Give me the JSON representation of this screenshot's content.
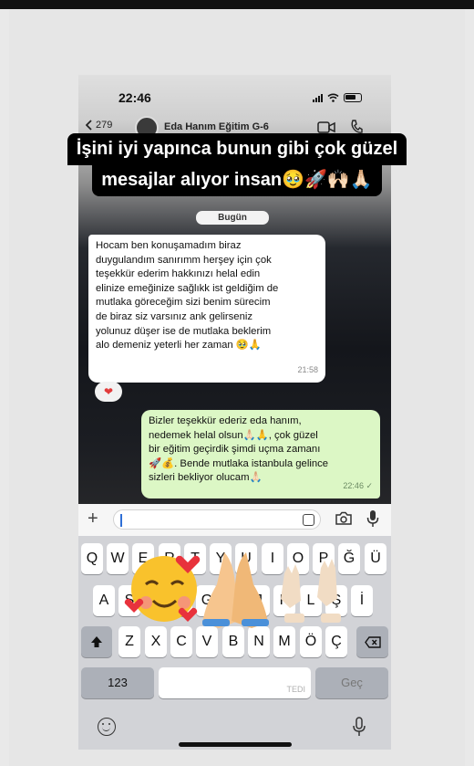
{
  "status_bar": {
    "time": "22:46"
  },
  "chat": {
    "back_count": "279",
    "contact_name": "Eda Hanım Eğitim G-6",
    "date_divider": "Bugün",
    "incoming": {
      "lines": [
        "Hocam ben konuşamadım biraz",
        "duygulandım sanırımm herşey için çok",
        "teşekkür ederim hakkınızı helal edin",
        "elinize emeğinize sağlıkk ist geldiğim de",
        "mutlaka göreceğim sizi  benim sürecim",
        "de biraz siz varsınız ank gelirseniz",
        "yolunuz düşer ise de mutlaka beklerim",
        "alo demeniz yeterli her zaman 🥹🙏"
      ],
      "time": "21:58",
      "reaction": "❤"
    },
    "outgoing": {
      "lines": [
        "Bizler teşekkür ederiz eda hanım,",
        "nedemek helal olsun🙏🏻🙏, çok güzel",
        "bir eğitim geçirdik şimdi uçma zamanı",
        "🚀💰. Bende mutlaka istanbula gelince",
        "sizleri bekliyor olucam🙏🏻"
      ],
      "time": "22:46 ✓"
    }
  },
  "story_caption": {
    "line1": "İşini iyi yapınca bunun gibi çok güzel",
    "line2": "mesajlar alıyor insan🥹🚀🙌🏻🙏🏻"
  },
  "keyboard": {
    "row1": [
      "Q",
      "W",
      "E",
      "R",
      "T",
      "Y",
      "U",
      "I",
      "O",
      "P",
      "Ğ",
      "Ü"
    ],
    "row2": [
      "A",
      "S",
      "D",
      "F",
      "G",
      "H",
      "J",
      "K",
      "L",
      "Ş",
      "İ"
    ],
    "row3": [
      "Z",
      "X",
      "C",
      "V",
      "B",
      "N",
      "M",
      "Ö",
      "Ç"
    ],
    "numbers_key": "123",
    "space_hint": "TEDI",
    "return_key": "Geç"
  },
  "icons": [
    "chevron-left-icon",
    "video-call-icon",
    "phone-call-icon",
    "plus-icon",
    "sticker-icon",
    "camera-icon",
    "microphone-icon",
    "shift-icon",
    "backspace-icon",
    "emoji-icon",
    "dictation-icon"
  ],
  "colors": {
    "incoming_bubble": "#ffffff",
    "outgoing_bubble": "#dcf7c5",
    "caption_bg": "#000000",
    "keyboard_bg": "#d2d3d7"
  }
}
